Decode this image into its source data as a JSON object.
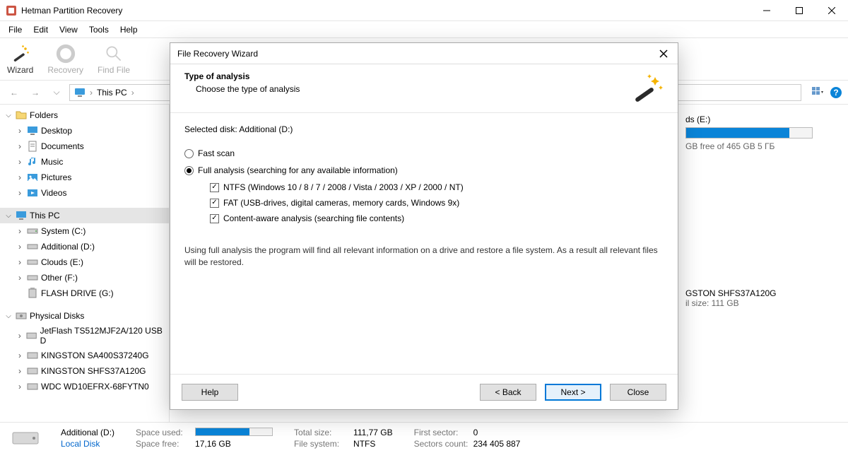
{
  "window": {
    "title": "Hetman Partition Recovery"
  },
  "menu": {
    "file": "File",
    "edit": "Edit",
    "view": "View",
    "tools": "Tools",
    "help": "Help"
  },
  "toolbar": {
    "wizard": "Wizard",
    "recovery": "Recovery",
    "findfile": "Find File"
  },
  "breadcrumb": {
    "root": "This PC"
  },
  "sidebar": {
    "folders": {
      "label": "Folders",
      "items": [
        "Desktop",
        "Documents",
        "Music",
        "Pictures",
        "Videos"
      ]
    },
    "thispc": {
      "label": "This PC",
      "items": [
        "System (C:)",
        "Additional (D:)",
        "Clouds (E:)",
        "Other (F:)",
        "FLASH DRIVE (G:)"
      ]
    },
    "physical": {
      "label": "Physical Disks",
      "items": [
        "JetFlash TS512MJF2A/120 USB D",
        "KINGSTON SA400S37240G",
        "KINGSTON SHFS37A120G",
        "WDC WD10EFRX-68FYTN0"
      ]
    }
  },
  "right_panel": {
    "volume": {
      "name": "ds (E:)",
      "free_text": "GB free of 465 GB   5 ГБ",
      "fill_pct": 82
    },
    "disk_info": {
      "model_frag": "GSTON SHFS37A120G",
      "size_frag": "il size: 111 GB"
    }
  },
  "statusbar": {
    "name": "Additional (D:)",
    "type": "Local Disk",
    "space_used_label": "Space used:",
    "space_free_label": "Space free:",
    "space_free": "17,16 GB",
    "used_pct": 70,
    "total_size_label": "Total size:",
    "total_size": "111,77 GB",
    "fs_label": "File system:",
    "fs": "NTFS",
    "first_sector_label": "First sector:",
    "first_sector": "0",
    "sectors_count_label": "Sectors count:",
    "sectors_count": "234 405 887"
  },
  "dialog": {
    "title": "File Recovery Wizard",
    "header": "Type of analysis",
    "subheader": "Choose the type of analysis",
    "selected_disk_label": "Selected disk:",
    "selected_disk": "Additional (D:)",
    "fast_scan": "Fast scan",
    "full_analysis": "Full analysis (searching for any available information)",
    "ntfs": "NTFS (Windows 10 / 8 / 7 / 2008 / Vista / 2003 / XP / 2000 / NT)",
    "fat": "FAT (USB-drives, digital cameras, memory cards, Windows 9x)",
    "content_aware": "Content-aware analysis (searching file contents)",
    "note": "Using full analysis the program will find all relevant information on a drive and restore a file system. As a result all relevant files will be restored.",
    "btn_help": "Help",
    "btn_back": "< Back",
    "btn_next": "Next >",
    "btn_close": "Close"
  }
}
